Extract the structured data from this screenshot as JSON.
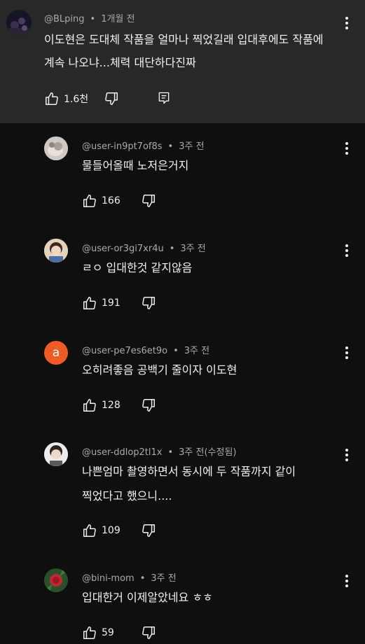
{
  "main": {
    "author": "@BLping",
    "time": "1개월 전",
    "lines": [
      "이도현은 도대체 작품을 얼마나 찍었길래 입대후에도 작품에",
      "계속 나오냐...체력 대단하다진짜"
    ],
    "likes": "1.6천"
  },
  "replies": [
    {
      "author": "@user-in9pt7of8s",
      "time": "3주 전",
      "lines": [
        "물들어올때 노저은거지"
      ],
      "likes": "166"
    },
    {
      "author": "@user-or3gi7xr4u",
      "time": "3주 전",
      "lines": [
        "ㄹㅇ 입대한것 같지않음"
      ],
      "likes": "191"
    },
    {
      "author": "@user-pe7es6et9o",
      "time": "3주 전",
      "lines": [
        "오히려좋음 공백기 줄이자 이도현"
      ],
      "likes": "128",
      "avatar_letter": "a"
    },
    {
      "author": "@user-ddlop2tl1x",
      "time": "3주 전(수정됨)",
      "lines": [
        "나쁜엄마 촬영하면서 동시에 두 작품까지 같이",
        "찍었다고 했으니...."
      ],
      "likes": "109"
    },
    {
      "author": "@bini-mom",
      "time": "3주 전",
      "lines": [
        "입대한거 이제알았네요 ㅎㅎ"
      ],
      "likes": "59"
    }
  ],
  "colors": {
    "background": "#0f0f0f",
    "highlight": "#282828",
    "meta": "#aaaaaa",
    "avatar_orange": "#ef5b25"
  }
}
